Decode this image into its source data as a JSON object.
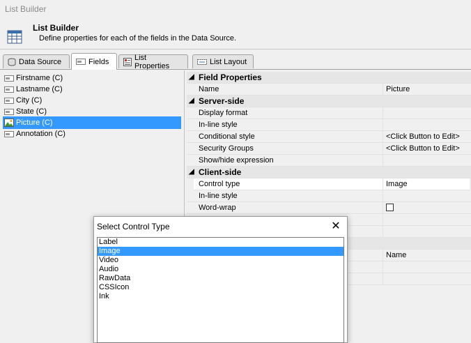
{
  "window": {
    "title": "List Builder"
  },
  "header": {
    "title": "List Builder",
    "subtitle": "Define properties for each of the fields in the Data Source."
  },
  "tabs": [
    {
      "label": "Data Source",
      "icon": "database-icon"
    },
    {
      "label": "Fields",
      "icon": "field-icon"
    },
    {
      "label": "List Properties",
      "icon": "properties-icon"
    },
    {
      "label": "List Layout",
      "icon": "layout-icon"
    }
  ],
  "fields": [
    {
      "label": "Firstname (C)"
    },
    {
      "label": "Lastname (C)"
    },
    {
      "label": "City (C)"
    },
    {
      "label": "State (C)"
    },
    {
      "label": "Picture (C)"
    },
    {
      "label": "Annotation (C)"
    }
  ],
  "properties": {
    "cat1": "Field Properties",
    "name_label": "Name",
    "name_value": "Picture",
    "cat2": "Server-side",
    "display_format": "Display format",
    "inline_style": "In-line style",
    "conditional_style": "Conditional style",
    "conditional_value": "<Click Button to Edit>",
    "security_groups": "Security Groups",
    "security_value": "<Click Button to Edit>",
    "showhide": "Show/hide expression",
    "cat3": "Client-side",
    "control_type": "Control type",
    "control_value": "Image",
    "inline_style2": "In-line style",
    "word_wrap": "Word-wrap",
    "lower_value": "Name"
  },
  "dialog": {
    "title": "Select Control Type",
    "options": [
      "Label",
      "Image",
      "Video",
      "Audio",
      "RawData",
      "CSSIcon",
      "Ink"
    ],
    "selected": "Image"
  }
}
